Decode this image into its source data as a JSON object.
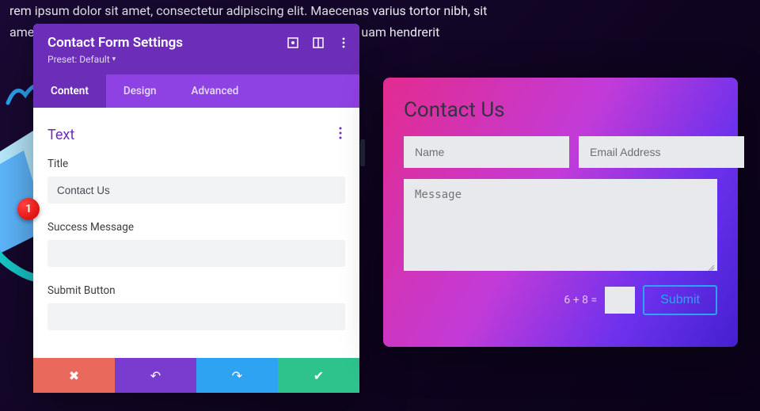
{
  "background_text": {
    "line1": "rem ipsum dolor sit amet, consectetur adipiscing elit. Maecenas varius tortor nibh, sit",
    "line2_left": "amet",
    "line2_right": "uam hendrerit"
  },
  "step_badge": "1",
  "panel": {
    "title": "Contact Form Settings",
    "preset_label": "Preset: Default",
    "header_icons": {
      "expand": "expand-icon",
      "columns": "columns-icon",
      "more": "more-icon"
    },
    "tabs": [
      {
        "label": "Content",
        "active": true
      },
      {
        "label": "Design",
        "active": false
      },
      {
        "label": "Advanced",
        "active": false
      }
    ],
    "section": {
      "title": "Text"
    },
    "fields": {
      "title": {
        "label": "Title",
        "value": "Contact Us"
      },
      "success": {
        "label": "Success Message",
        "value": ""
      },
      "submit": {
        "label": "Submit Button",
        "value": ""
      }
    }
  },
  "form": {
    "title": "Contact Us",
    "name_placeholder": "Name",
    "email_placeholder": "Email Address",
    "message_placeholder": "Message",
    "captcha_label": "6 + 8 =",
    "submit_label": "Submit"
  }
}
